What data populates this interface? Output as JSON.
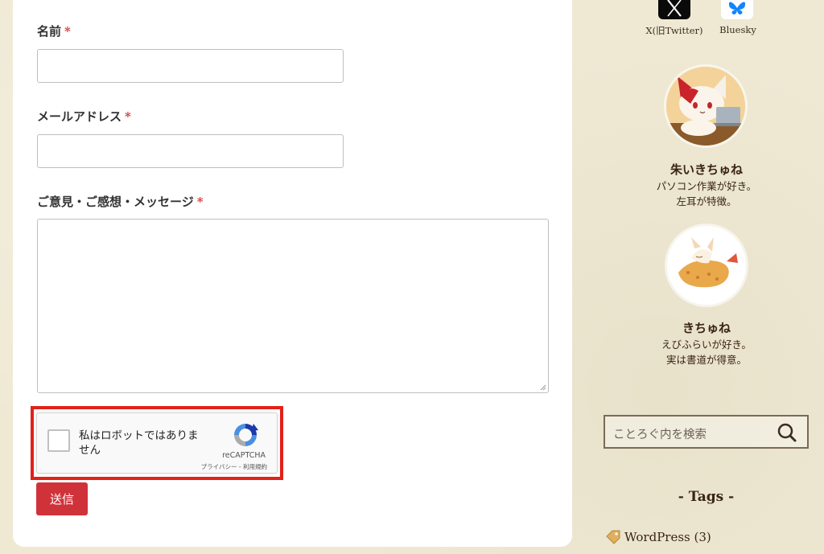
{
  "form": {
    "name_label": "名前",
    "email_label": "メールアドレス",
    "message_label": "ご意見・ご感想・メッセージ",
    "required_mark": "*",
    "name_value": "",
    "email_value": "",
    "message_value": "",
    "submit_label": "送信"
  },
  "recaptcha": {
    "label": "私はロボットではありません",
    "brand": "reCAPTCHA",
    "links": "プライバシー - 利用規約"
  },
  "sidebar": {
    "sns": [
      {
        "label": "X(旧Twitter)",
        "icon": "x-logo-icon"
      },
      {
        "label": "Bluesky",
        "icon": "bluesky-butterfly-icon"
      }
    ],
    "profiles": [
      {
        "name": "朱いきちゅね",
        "desc_line1": "パソコン作業が好き。",
        "desc_line2": "左耳が特徴。"
      },
      {
        "name": "きちゅね",
        "desc_line1": "えびふらいが好き。",
        "desc_line2": "実は書道が得意。"
      }
    ],
    "search_placeholder": "ことろぐ内を検索",
    "tags_title": "- Tags -",
    "tags": [
      {
        "label": "WordPress (3)"
      }
    ]
  },
  "colors": {
    "accent_red": "#d0323a",
    "highlight_red": "#e22119",
    "paper_bg": "#efe9d4",
    "text_brown": "#3a2414"
  }
}
